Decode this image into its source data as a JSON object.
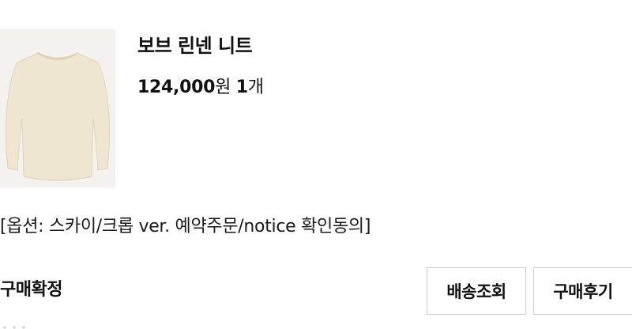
{
  "order_item": {
    "image_icon": "knit-sweater-image",
    "product_name": "보브 린넨 니트",
    "price": "124,000",
    "price_unit": "원",
    "quantity": "1",
    "quantity_unit": "개",
    "option": "[옵션: 스카이/크롭 ver. 예약주문/notice 확인동의]"
  },
  "status": {
    "label": "구매확정"
  },
  "actions": {
    "tracking_label": "배송조회",
    "review_label": "구매후기"
  },
  "colors": {
    "sweater": "#efe6d2",
    "thumb_background": "#f4f2ee",
    "button_border": "#cfcfcf",
    "text": "#111111"
  }
}
